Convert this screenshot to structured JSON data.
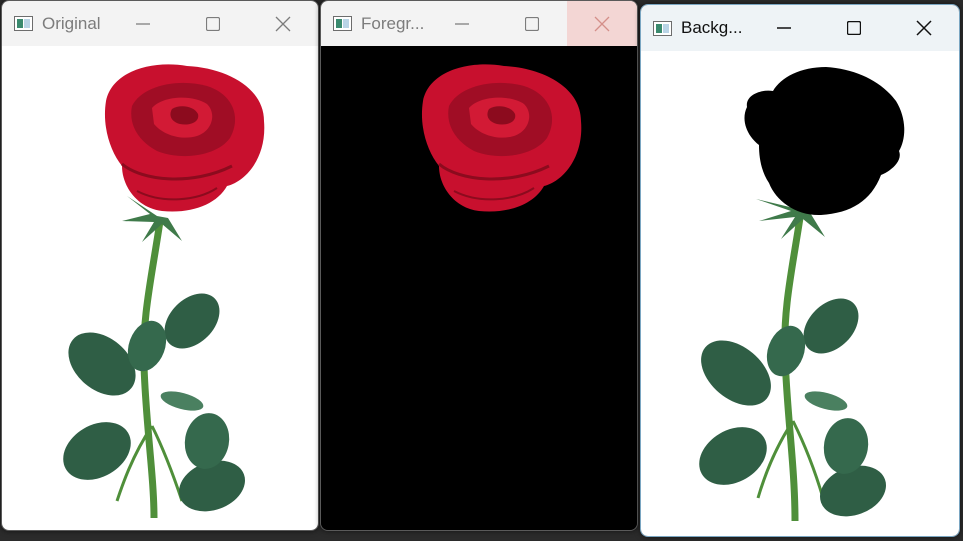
{
  "windows": [
    {
      "title": "Original",
      "icon": "app-window-icon",
      "controls": [
        "minimize",
        "maximize",
        "close"
      ],
      "state": "inactive"
    },
    {
      "title": "Foregr...",
      "icon": "app-window-icon",
      "controls": [
        "minimize",
        "maximize",
        "close"
      ],
      "state": "inactive-close-hover"
    },
    {
      "title": "Backg...",
      "icon": "app-window-icon",
      "controls": [
        "minimize",
        "maximize",
        "close"
      ],
      "state": "active"
    }
  ],
  "colors": {
    "rose": "#c8102e",
    "rose_dark": "#8c0b1e",
    "leaf": "#2f5e45",
    "stem": "#4f8f3a",
    "mask": "#000000",
    "background": "#ffffff"
  }
}
